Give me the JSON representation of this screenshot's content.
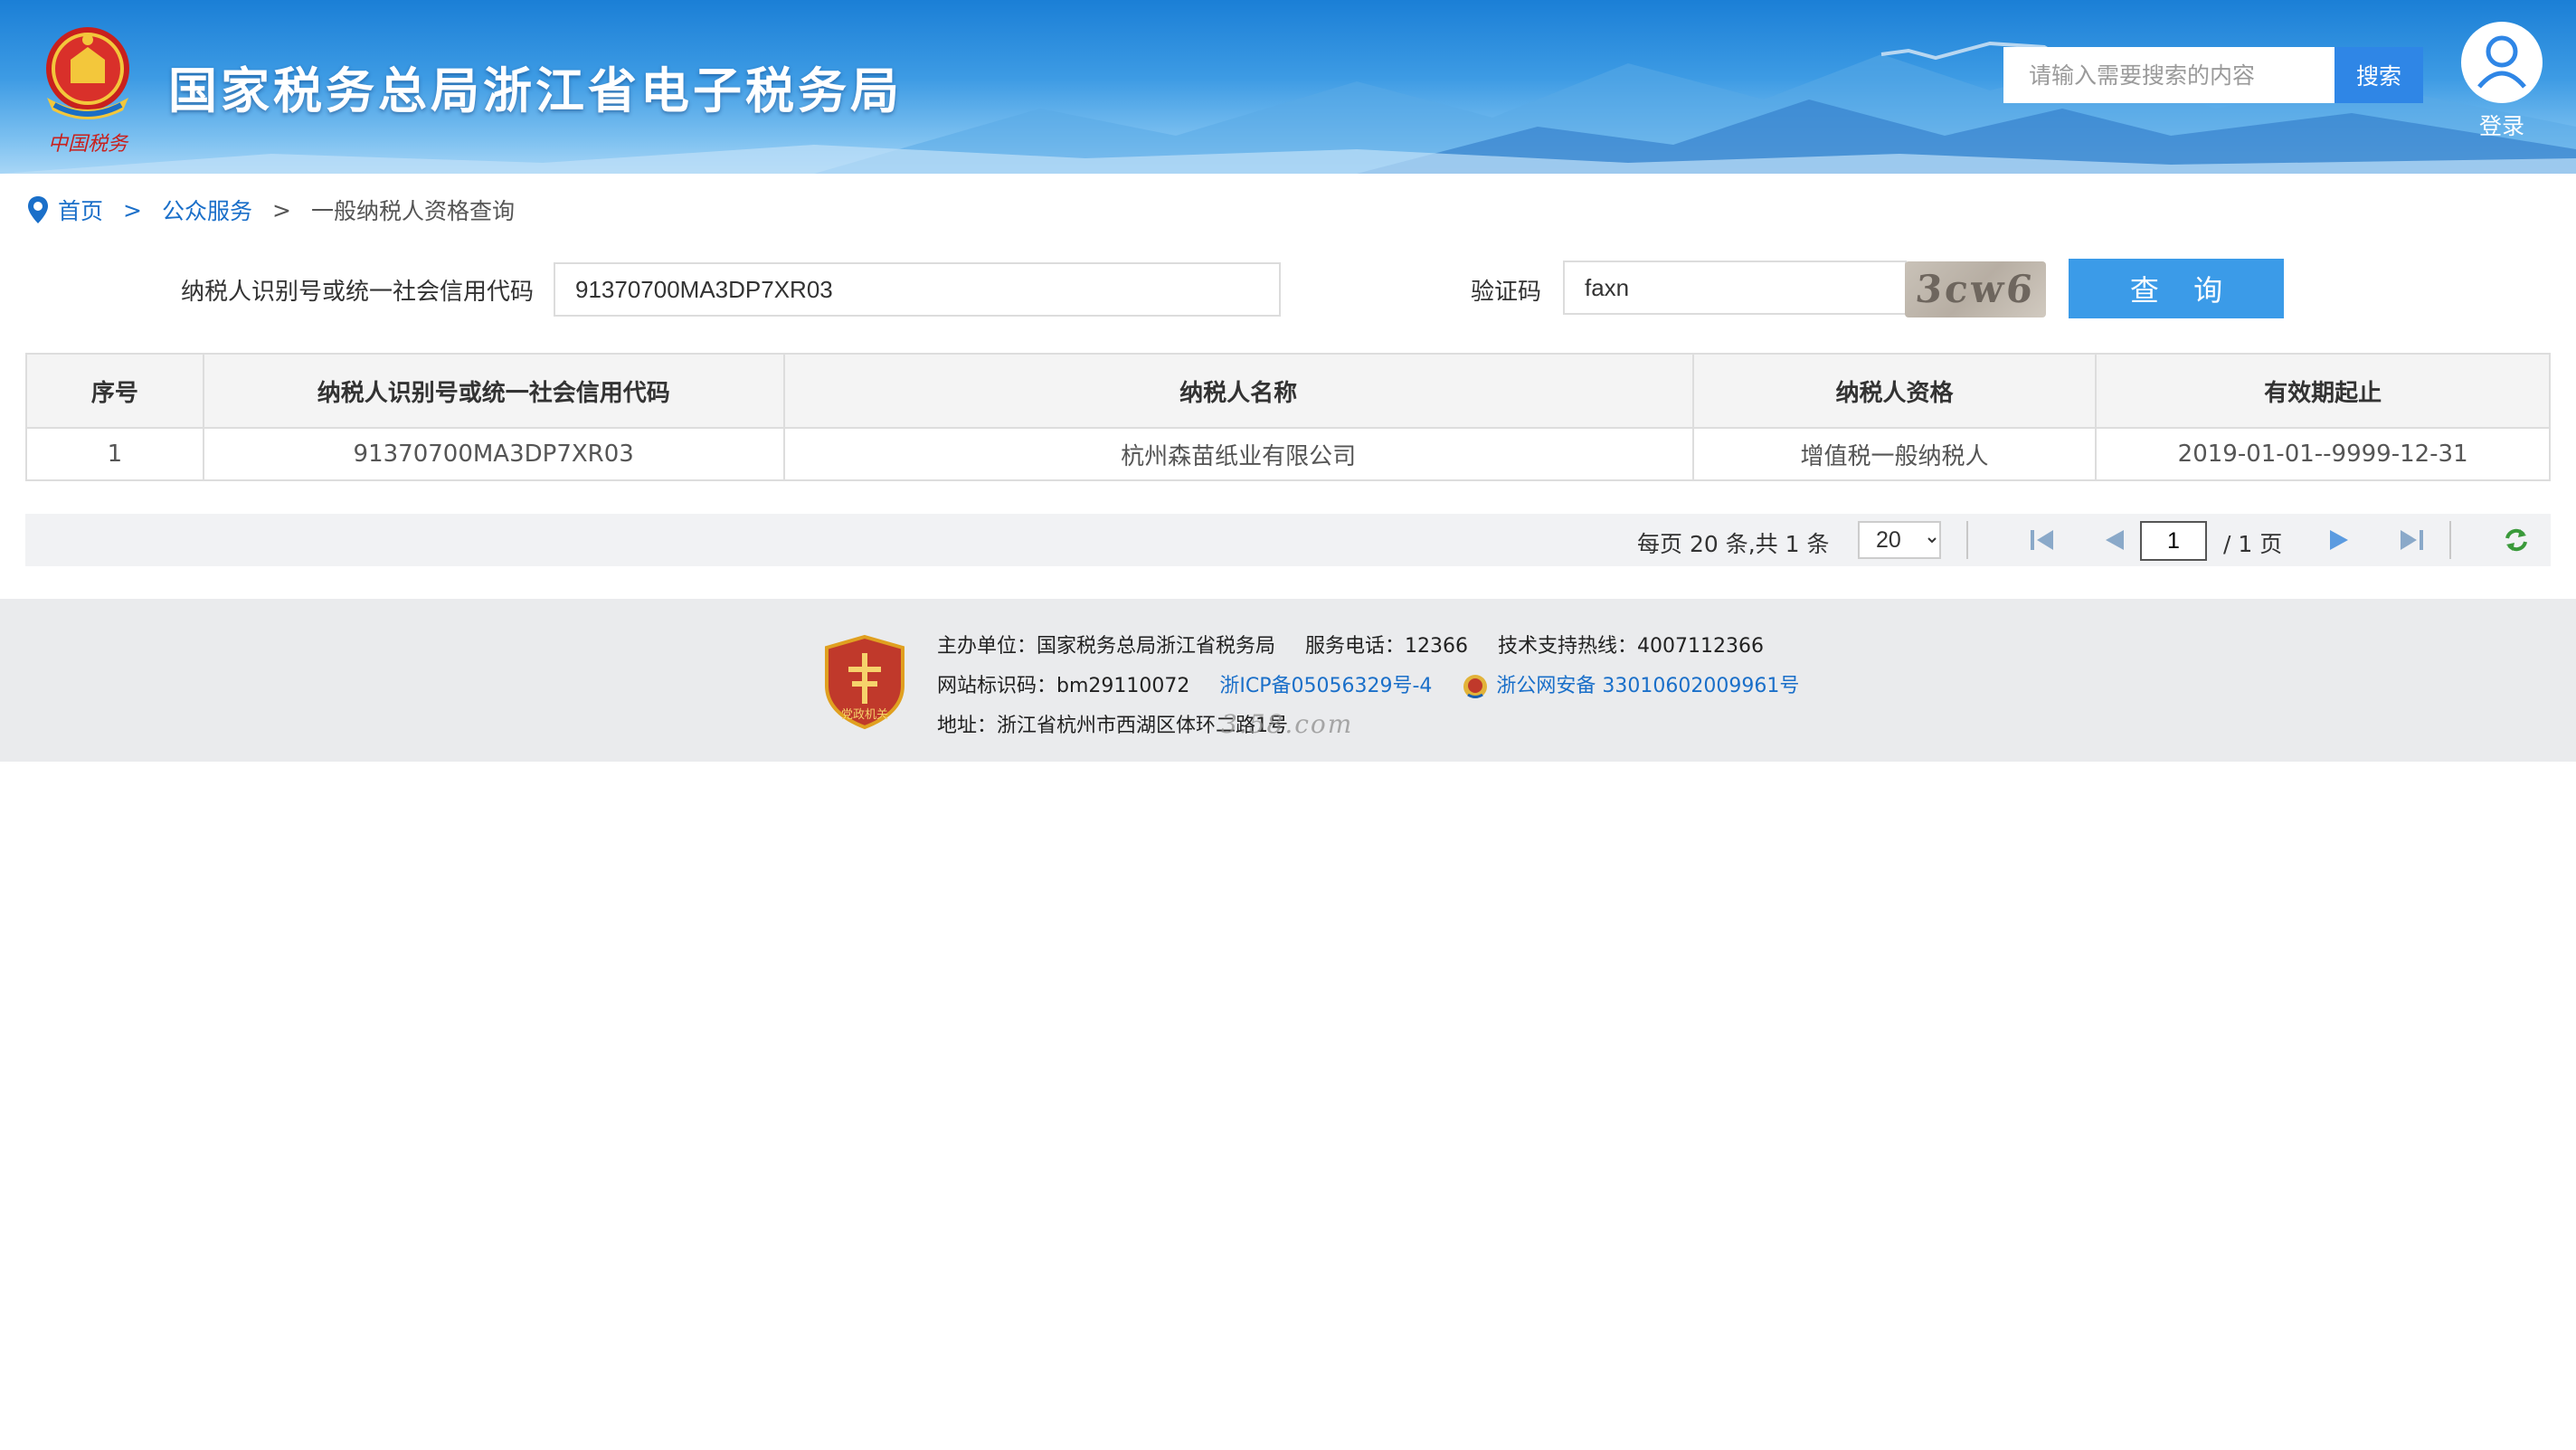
{
  "header": {
    "site_title": "国家税务总局浙江省电子税务局",
    "emblem_text": "中国税务",
    "search_placeholder": "请输入需要搜索的内容",
    "search_button": "搜索",
    "login_label": "登录"
  },
  "breadcrumb": {
    "home": "首页",
    "separator": ">",
    "section": "公众服务",
    "current": "一般纳税人资格查询"
  },
  "form": {
    "taxpayer_id_label": "纳税人识别号或统一社会信用代码",
    "taxpayer_id_value": "91370700MA3DP7XR03",
    "captcha_label": "验证码",
    "captcha_value": "faxn",
    "captcha_image_text": "3cw6",
    "query_button": "查 询"
  },
  "table": {
    "columns": [
      "序号",
      "纳税人识别号或统一社会信用代码",
      "纳税人名称",
      "纳税人资格",
      "有效期起止"
    ],
    "rows": [
      [
        "1",
        "91370700MA3DP7XR03",
        "杭州森苗纸业有限公司",
        "增值税一般纳税人",
        "2019-01-01--9999-12-31"
      ]
    ]
  },
  "pager": {
    "info": "每页 20 条,共 1 条",
    "page_size": "20",
    "current_page": "1",
    "total_pages": "/ 1 页",
    "icons": [
      "first-page-icon",
      "prev-page-icon",
      "next-page-icon",
      "last-page-icon",
      "refresh-icon"
    ]
  },
  "footer": {
    "sponsor": "主办单位：国家税务总局浙江省税务局",
    "phone": "服务电话：12366",
    "support": "技术支持热线：4007112366",
    "site_id": "网站标识码：bm29110072",
    "icp": "浙ICP备05056329号-4",
    "police": "浙公网安备 33010602009961号",
    "address": "地址：浙江省杭州市西湖区体环二路1号",
    "watermark": "3.58.com",
    "badge_text": "党政机关"
  },
  "colors": {
    "brand_blue": "#2f86e6",
    "query_blue": "#3b9be8",
    "link_blue": "#1a6fc9"
  }
}
